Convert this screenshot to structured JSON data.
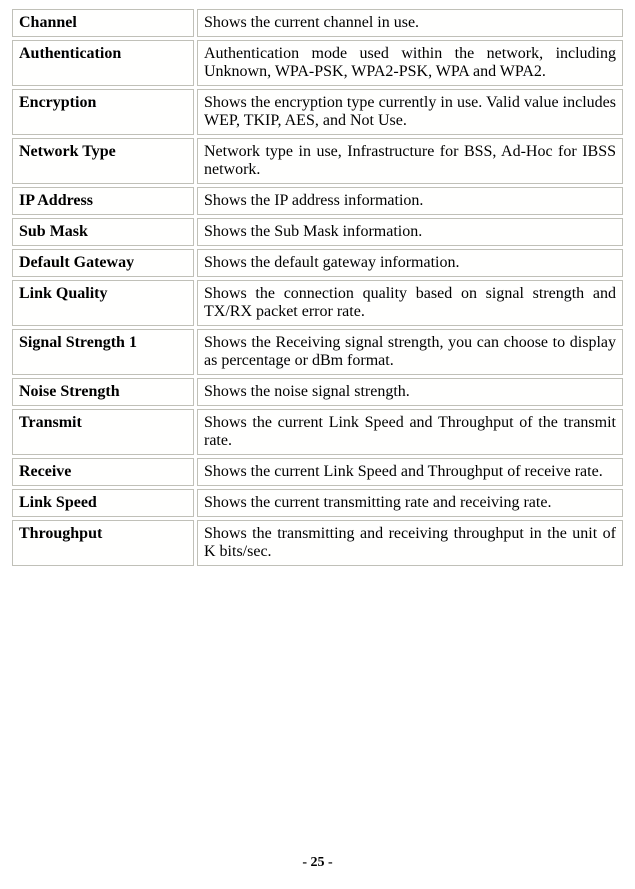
{
  "rows": [
    {
      "label": "Channel",
      "desc": "Shows the current channel in use."
    },
    {
      "label": "Authentication",
      "desc": "Authentication mode used within the network, including Unknown, WPA-PSK, WPA2-PSK, WPA and WPA2."
    },
    {
      "label": "Encryption",
      "desc": "Shows the encryption type currently in use. Valid value includes WEP, TKIP, AES, and Not Use."
    },
    {
      "label": "Network Type",
      "desc": "Network type in use, Infrastructure for BSS, Ad-Hoc for IBSS network."
    },
    {
      "label": "IP Address",
      "desc": "Shows the IP address information."
    },
    {
      "label": "Sub Mask",
      "desc": "Shows the Sub Mask information."
    },
    {
      "label": "Default Gateway",
      "desc": "Shows the default gateway information."
    },
    {
      "label": "Link Quality",
      "desc": "Shows the connection quality based on signal strength and TX/RX packet error rate."
    },
    {
      "label": "Signal Strength 1",
      "desc": "Shows the Receiving signal strength, you can choose to display as percentage or dBm format."
    },
    {
      "label": "Noise Strength",
      "desc": "Shows the noise signal strength."
    },
    {
      "label": "Transmit",
      "desc": "Shows the current Link Speed and Throughput of the transmit rate."
    },
    {
      "label": "Receive",
      "desc": "Shows the current Link Speed and Throughput of receive rate."
    },
    {
      "label": "Link Speed",
      "desc": "Shows the current transmitting rate and receiving rate."
    },
    {
      "label": "Throughput",
      "desc": "Shows the transmitting and receiving throughput in the unit of K bits/sec."
    }
  ],
  "page_number": "- 25 -"
}
